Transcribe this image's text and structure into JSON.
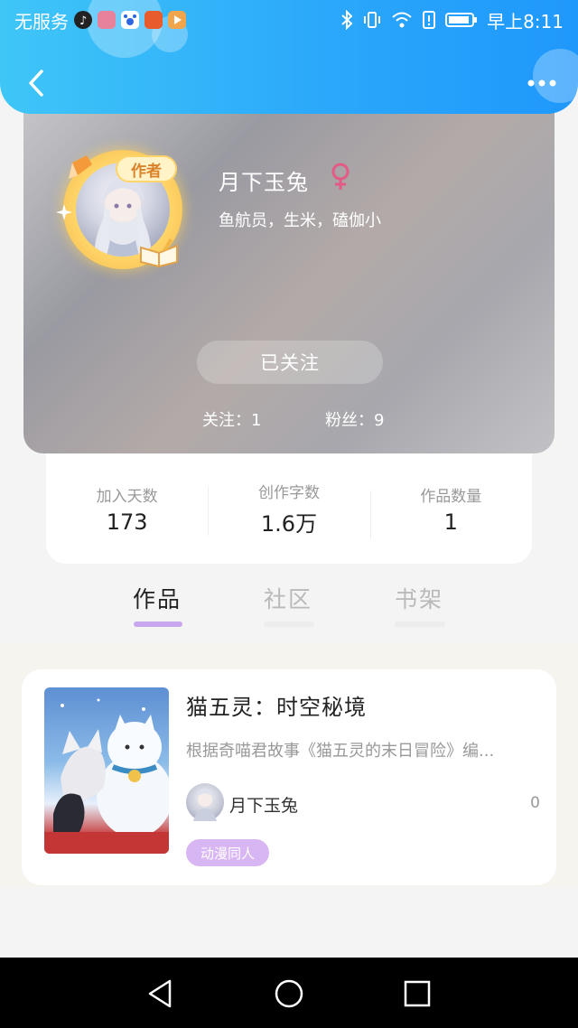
{
  "status_bar": {
    "carrier": "无服务",
    "time": "早上8:11",
    "icons": [
      "tiktok-icon",
      "app-icon",
      "baidu-icon",
      "news-icon",
      "video-icon",
      "bluetooth-icon",
      "vibrate-icon",
      "wifi-icon",
      "alert-icon",
      "battery-icon"
    ]
  },
  "header": {
    "back_icon": "chevron-left-icon",
    "more_icon": "more-dots-icon",
    "gradient_start": "#3fc6f7",
    "gradient_end": "#1f98fb"
  },
  "profile": {
    "author_badge": "作者",
    "username": "月下玉兔",
    "gender_icon": "female-icon",
    "gender_color": "#e35a85",
    "bio": "鱼航员，生米，磕伽小",
    "follow_button": "已关注",
    "following_label": "关注：1",
    "fans_label": "粉丝：9"
  },
  "stats": [
    {
      "label": "加入天数",
      "value": "173"
    },
    {
      "label": "创作字数",
      "value": "1.6万"
    },
    {
      "label": "作品数量",
      "value": "1"
    }
  ],
  "tabs": [
    {
      "label": "作品",
      "active": true
    },
    {
      "label": "社区",
      "active": false
    },
    {
      "label": "书架",
      "active": false
    }
  ],
  "works": [
    {
      "title": "猫五灵：时空秘境",
      "description": "根据奇喵君故事《猫五灵的末日冒险》编...",
      "author": "月下玉兔",
      "count": "0",
      "tag": "动漫同人",
      "tag_color": "#d8b6f4"
    }
  ],
  "system_nav": {
    "back_icon": "triangle-back-icon",
    "home_icon": "circle-home-icon",
    "recent_icon": "square-recent-icon"
  }
}
